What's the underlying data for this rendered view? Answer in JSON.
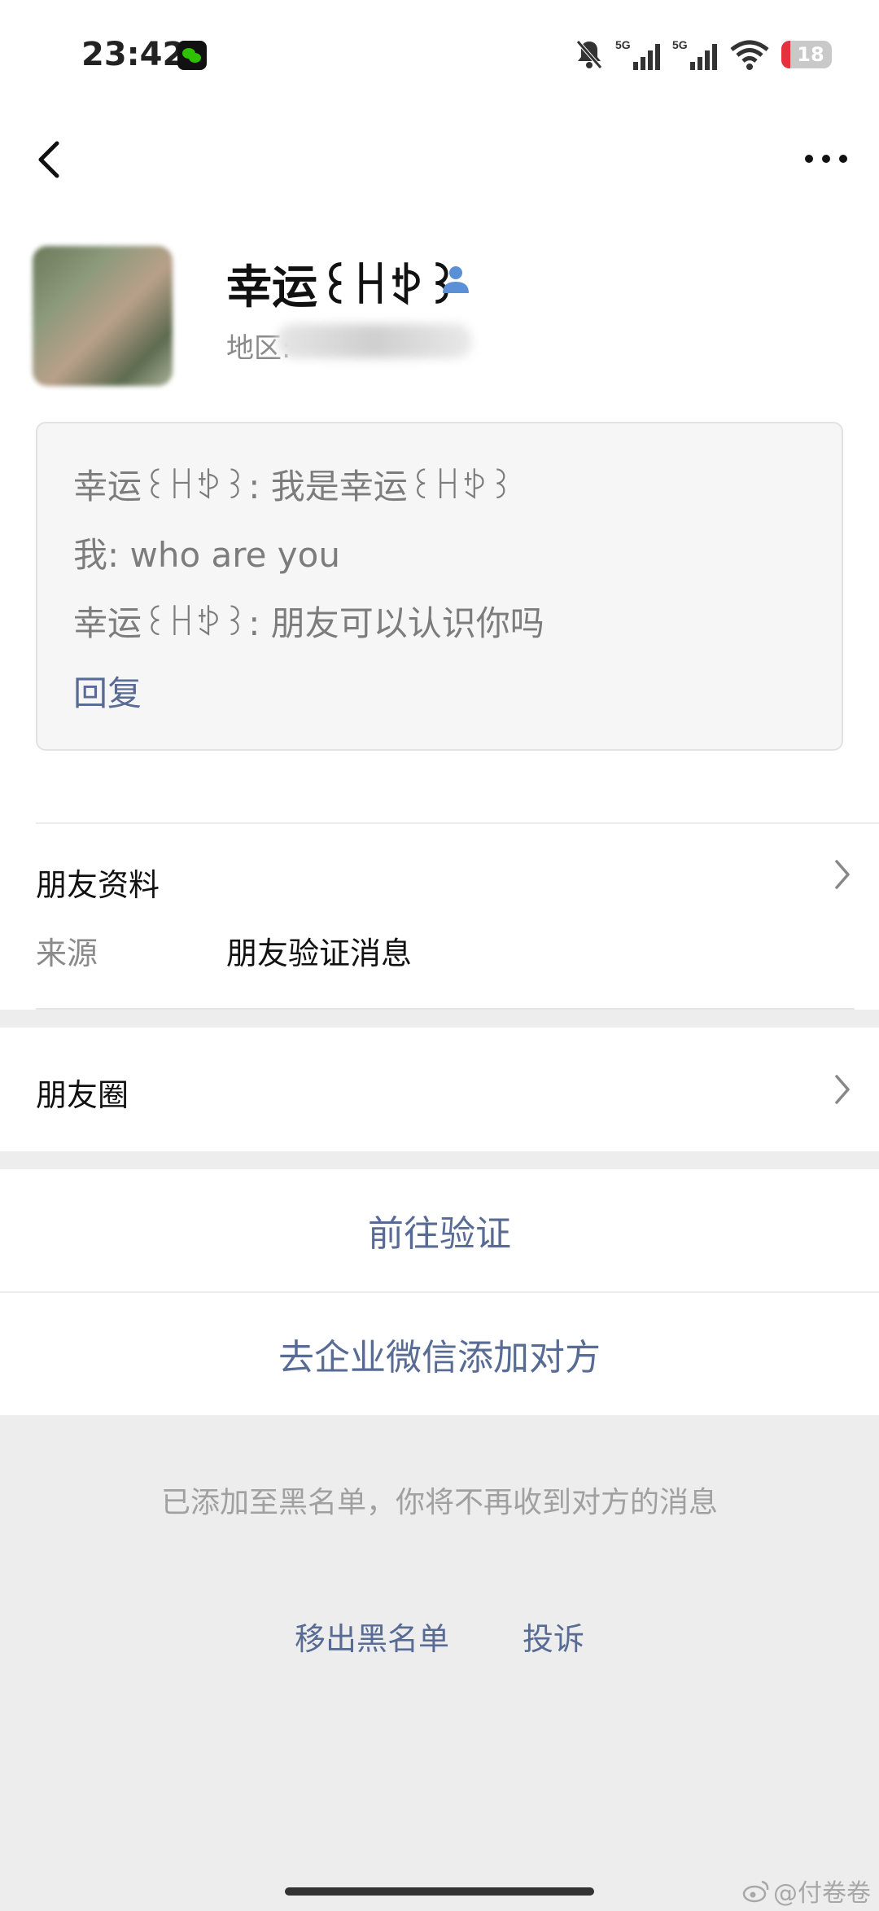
{
  "status_bar": {
    "time": "23:42",
    "battery_level": "18",
    "network_1": "5G",
    "network_2": "5G"
  },
  "nav": {
    "back_icon": "chevron-left-icon",
    "more_icon": "more-horizontal-icon"
  },
  "profile": {
    "nickname": "幸运꒰ꀿꉣ꒱",
    "region_label": "地区:"
  },
  "verification_messages": {
    "lines": [
      "幸运꒰ꀿꉣ꒱: 我是幸运꒰ꀿꉣ꒱",
      "我: who are you",
      "幸运꒰ꀿꉣ꒱: 朋友可以认识你吗"
    ],
    "reply_label": "回复"
  },
  "friend_info": {
    "title": "朋友资料",
    "source_label": "来源",
    "source_value": "朋友验证消息"
  },
  "moments": {
    "label": "朋友圈"
  },
  "actions": {
    "verify_label": "前往验证",
    "enterprise_label": "去企业微信添加对方"
  },
  "blacklist": {
    "note": "已添加至黑名单，你将不再收到对方的消息",
    "remove_label": "移出黑名单",
    "report_label": "投诉"
  },
  "watermark": {
    "text": "@付卷卷"
  },
  "colors": {
    "link": "#576b95",
    "background": "#ededed",
    "battery_low": "#e5323e"
  }
}
